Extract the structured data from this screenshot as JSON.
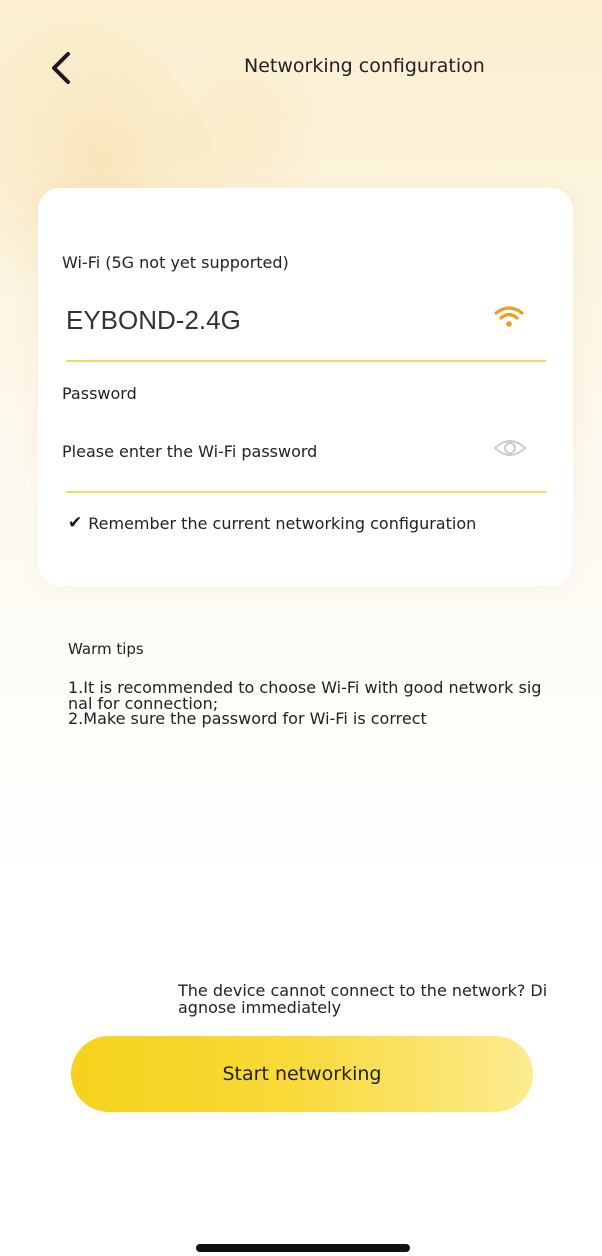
{
  "header": {
    "title": "Networking configuration",
    "back_icon": "chevron-left-icon"
  },
  "form": {
    "wifi_label": "Wi-Fi (5G not yet supported)",
    "ssid": "EYBOND-2.4G",
    "wifi_icon": "wifi-signal-icon",
    "password_label": "Password",
    "password_placeholder": "Please enter the Wi-Fi password",
    "password_value": "",
    "eye_icon": "eye-icon",
    "remember_check": "✔",
    "remember_label": "Remember the current networking configuration"
  },
  "tips": {
    "title": "Warm tips",
    "tip1": "1.It is recommended to choose Wi-Fi with good network signal for connection;",
    "tip2": "2.Make sure the password for Wi-Fi is correct"
  },
  "diagnose_text": "The device cannot connect to the network? Diagnose immediately",
  "start_button_label": "Start networking",
  "colors": {
    "accent": "#f6d21c",
    "underline": "#f3dc5a",
    "wifi_icon": "#f39a1e"
  }
}
